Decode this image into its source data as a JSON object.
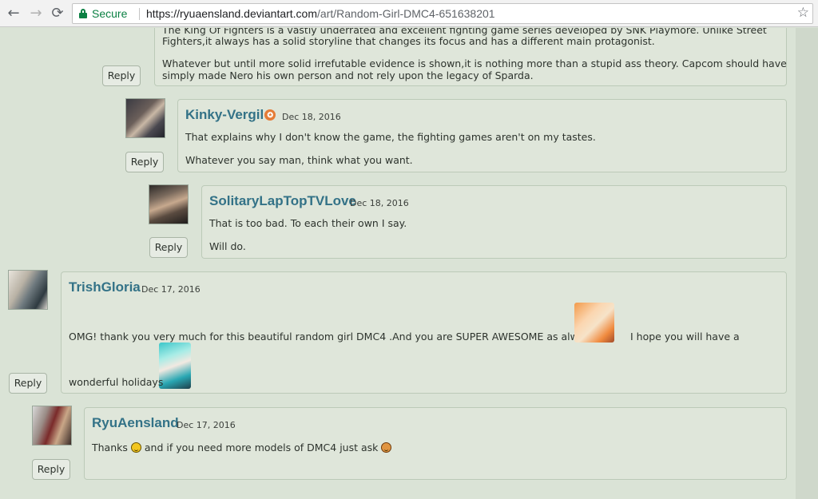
{
  "browser": {
    "back_icon": "←",
    "forward_icon": "→",
    "reload_icon": "⟳",
    "secure_label": "Secure",
    "url_base": "https://ryuaensland.deviantart.com",
    "url_path": "/art/Random-Girl-DMC4-651638201",
    "star_icon": "☆"
  },
  "comments": [
    {
      "author": "",
      "date": "",
      "lines": [
        "The King Of Fighters is a vastly underrated and excellent fighting game series developed by SNK Playmore. Unlike Street",
        "Fighters,it always has a solid storyline that changes its focus and has a different main protagonist.",
        "Whatever but until more solid irrefutable evidence is shown,it is nothing more than a stupid ass theory. Capcom should have",
        "simply made Nero his own person and not rely upon the legacy of Sparda."
      ],
      "reply": "Reply"
    },
    {
      "author": "Kinky-Vergil",
      "date": "Dec 18, 2016",
      "lines": [
        "That explains why I don't know the game, the fighting games aren't on my tastes.",
        "Whatever you say man, think what you want."
      ],
      "reply": "Reply"
    },
    {
      "author": "SolitaryLapTopTVLove",
      "date": "Dec 18, 2016",
      "lines": [
        "That is too bad. To each their own I say.",
        "Will do."
      ],
      "reply": "Reply"
    },
    {
      "author": "TrishGloria",
      "date": "Dec 17, 2016",
      "lines": [
        "OMG! thank you very much for this beautiful random girl DMC4 .And you are SUPER AWESOME as always",
        "I hope you will have a",
        "wonderful holidays"
      ],
      "reply": "Reply"
    },
    {
      "author": "RyuAensland",
      "date": "Dec 17, 2016",
      "lines": [
        "Thanks",
        "and if you need more models of DMC4 just ask"
      ],
      "reply": "Reply"
    }
  ],
  "colors": {
    "page_bg": "#dae3d6",
    "author_link": "#337287",
    "secure_green": "#0b8043"
  }
}
